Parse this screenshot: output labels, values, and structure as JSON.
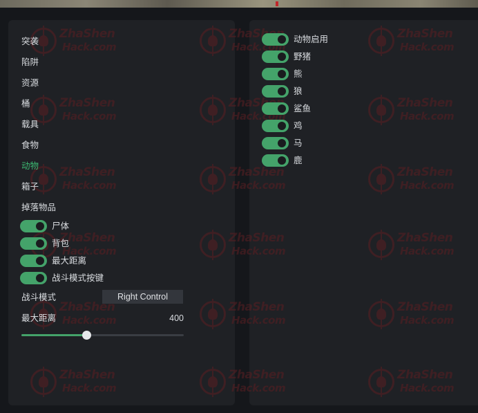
{
  "categories": [
    "突袭",
    "陷阱",
    "资源",
    "桶",
    "载具",
    "食物",
    "动物",
    "箱子",
    "掉落物品"
  ],
  "active_category": "动物",
  "left_toggles": [
    {
      "label": "尸体",
      "on": true
    },
    {
      "label": "背包",
      "on": true
    },
    {
      "label": "最大距离",
      "on": true
    },
    {
      "label": "战斗模式按键",
      "on": true
    }
  ],
  "keybind": {
    "label": "战斗模式",
    "value": "Right Control"
  },
  "slider": {
    "label": "最大距离",
    "value": "400",
    "fraction": 0.4
  },
  "right_toggles": [
    {
      "label": "动物启用",
      "on": true
    },
    {
      "label": "野猪",
      "on": true
    },
    {
      "label": "熊",
      "on": true
    },
    {
      "label": "狼",
      "on": true
    },
    {
      "label": "鲨鱼",
      "on": true
    },
    {
      "label": "鸡",
      "on": true
    },
    {
      "label": "马",
      "on": true
    },
    {
      "label": "鹿",
      "on": true
    }
  ],
  "watermark": {
    "line1": "ZhaShen",
    "line2": "Hack.com"
  },
  "colors": {
    "accent": "#44a36a",
    "active_text": "#3dba72",
    "panel": "#1f2125",
    "background": "#15171b"
  }
}
